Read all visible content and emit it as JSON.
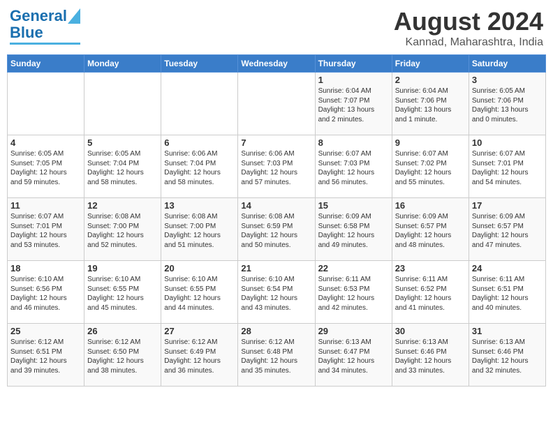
{
  "header": {
    "logo_line1": "General",
    "logo_line2": "Blue",
    "month": "August 2024",
    "location": "Kannad, Maharashtra, India"
  },
  "weekdays": [
    "Sunday",
    "Monday",
    "Tuesday",
    "Wednesday",
    "Thursday",
    "Friday",
    "Saturday"
  ],
  "weeks": [
    [
      {
        "day": "",
        "info": ""
      },
      {
        "day": "",
        "info": ""
      },
      {
        "day": "",
        "info": ""
      },
      {
        "day": "",
        "info": ""
      },
      {
        "day": "1",
        "info": "Sunrise: 6:04 AM\nSunset: 7:07 PM\nDaylight: 13 hours\nand 2 minutes."
      },
      {
        "day": "2",
        "info": "Sunrise: 6:04 AM\nSunset: 7:06 PM\nDaylight: 13 hours\nand 1 minute."
      },
      {
        "day": "3",
        "info": "Sunrise: 6:05 AM\nSunset: 7:06 PM\nDaylight: 13 hours\nand 0 minutes."
      }
    ],
    [
      {
        "day": "4",
        "info": "Sunrise: 6:05 AM\nSunset: 7:05 PM\nDaylight: 12 hours\nand 59 minutes."
      },
      {
        "day": "5",
        "info": "Sunrise: 6:05 AM\nSunset: 7:04 PM\nDaylight: 12 hours\nand 58 minutes."
      },
      {
        "day": "6",
        "info": "Sunrise: 6:06 AM\nSunset: 7:04 PM\nDaylight: 12 hours\nand 58 minutes."
      },
      {
        "day": "7",
        "info": "Sunrise: 6:06 AM\nSunset: 7:03 PM\nDaylight: 12 hours\nand 57 minutes."
      },
      {
        "day": "8",
        "info": "Sunrise: 6:07 AM\nSunset: 7:03 PM\nDaylight: 12 hours\nand 56 minutes."
      },
      {
        "day": "9",
        "info": "Sunrise: 6:07 AM\nSunset: 7:02 PM\nDaylight: 12 hours\nand 55 minutes."
      },
      {
        "day": "10",
        "info": "Sunrise: 6:07 AM\nSunset: 7:01 PM\nDaylight: 12 hours\nand 54 minutes."
      }
    ],
    [
      {
        "day": "11",
        "info": "Sunrise: 6:07 AM\nSunset: 7:01 PM\nDaylight: 12 hours\nand 53 minutes."
      },
      {
        "day": "12",
        "info": "Sunrise: 6:08 AM\nSunset: 7:00 PM\nDaylight: 12 hours\nand 52 minutes."
      },
      {
        "day": "13",
        "info": "Sunrise: 6:08 AM\nSunset: 7:00 PM\nDaylight: 12 hours\nand 51 minutes."
      },
      {
        "day": "14",
        "info": "Sunrise: 6:08 AM\nSunset: 6:59 PM\nDaylight: 12 hours\nand 50 minutes."
      },
      {
        "day": "15",
        "info": "Sunrise: 6:09 AM\nSunset: 6:58 PM\nDaylight: 12 hours\nand 49 minutes."
      },
      {
        "day": "16",
        "info": "Sunrise: 6:09 AM\nSunset: 6:57 PM\nDaylight: 12 hours\nand 48 minutes."
      },
      {
        "day": "17",
        "info": "Sunrise: 6:09 AM\nSunset: 6:57 PM\nDaylight: 12 hours\nand 47 minutes."
      }
    ],
    [
      {
        "day": "18",
        "info": "Sunrise: 6:10 AM\nSunset: 6:56 PM\nDaylight: 12 hours\nand 46 minutes."
      },
      {
        "day": "19",
        "info": "Sunrise: 6:10 AM\nSunset: 6:55 PM\nDaylight: 12 hours\nand 45 minutes."
      },
      {
        "day": "20",
        "info": "Sunrise: 6:10 AM\nSunset: 6:55 PM\nDaylight: 12 hours\nand 44 minutes."
      },
      {
        "day": "21",
        "info": "Sunrise: 6:10 AM\nSunset: 6:54 PM\nDaylight: 12 hours\nand 43 minutes."
      },
      {
        "day": "22",
        "info": "Sunrise: 6:11 AM\nSunset: 6:53 PM\nDaylight: 12 hours\nand 42 minutes."
      },
      {
        "day": "23",
        "info": "Sunrise: 6:11 AM\nSunset: 6:52 PM\nDaylight: 12 hours\nand 41 minutes."
      },
      {
        "day": "24",
        "info": "Sunrise: 6:11 AM\nSunset: 6:51 PM\nDaylight: 12 hours\nand 40 minutes."
      }
    ],
    [
      {
        "day": "25",
        "info": "Sunrise: 6:12 AM\nSunset: 6:51 PM\nDaylight: 12 hours\nand 39 minutes."
      },
      {
        "day": "26",
        "info": "Sunrise: 6:12 AM\nSunset: 6:50 PM\nDaylight: 12 hours\nand 38 minutes."
      },
      {
        "day": "27",
        "info": "Sunrise: 6:12 AM\nSunset: 6:49 PM\nDaylight: 12 hours\nand 36 minutes."
      },
      {
        "day": "28",
        "info": "Sunrise: 6:12 AM\nSunset: 6:48 PM\nDaylight: 12 hours\nand 35 minutes."
      },
      {
        "day": "29",
        "info": "Sunrise: 6:13 AM\nSunset: 6:47 PM\nDaylight: 12 hours\nand 34 minutes."
      },
      {
        "day": "30",
        "info": "Sunrise: 6:13 AM\nSunset: 6:46 PM\nDaylight: 12 hours\nand 33 minutes."
      },
      {
        "day": "31",
        "info": "Sunrise: 6:13 AM\nSunset: 6:46 PM\nDaylight: 12 hours\nand 32 minutes."
      }
    ]
  ]
}
